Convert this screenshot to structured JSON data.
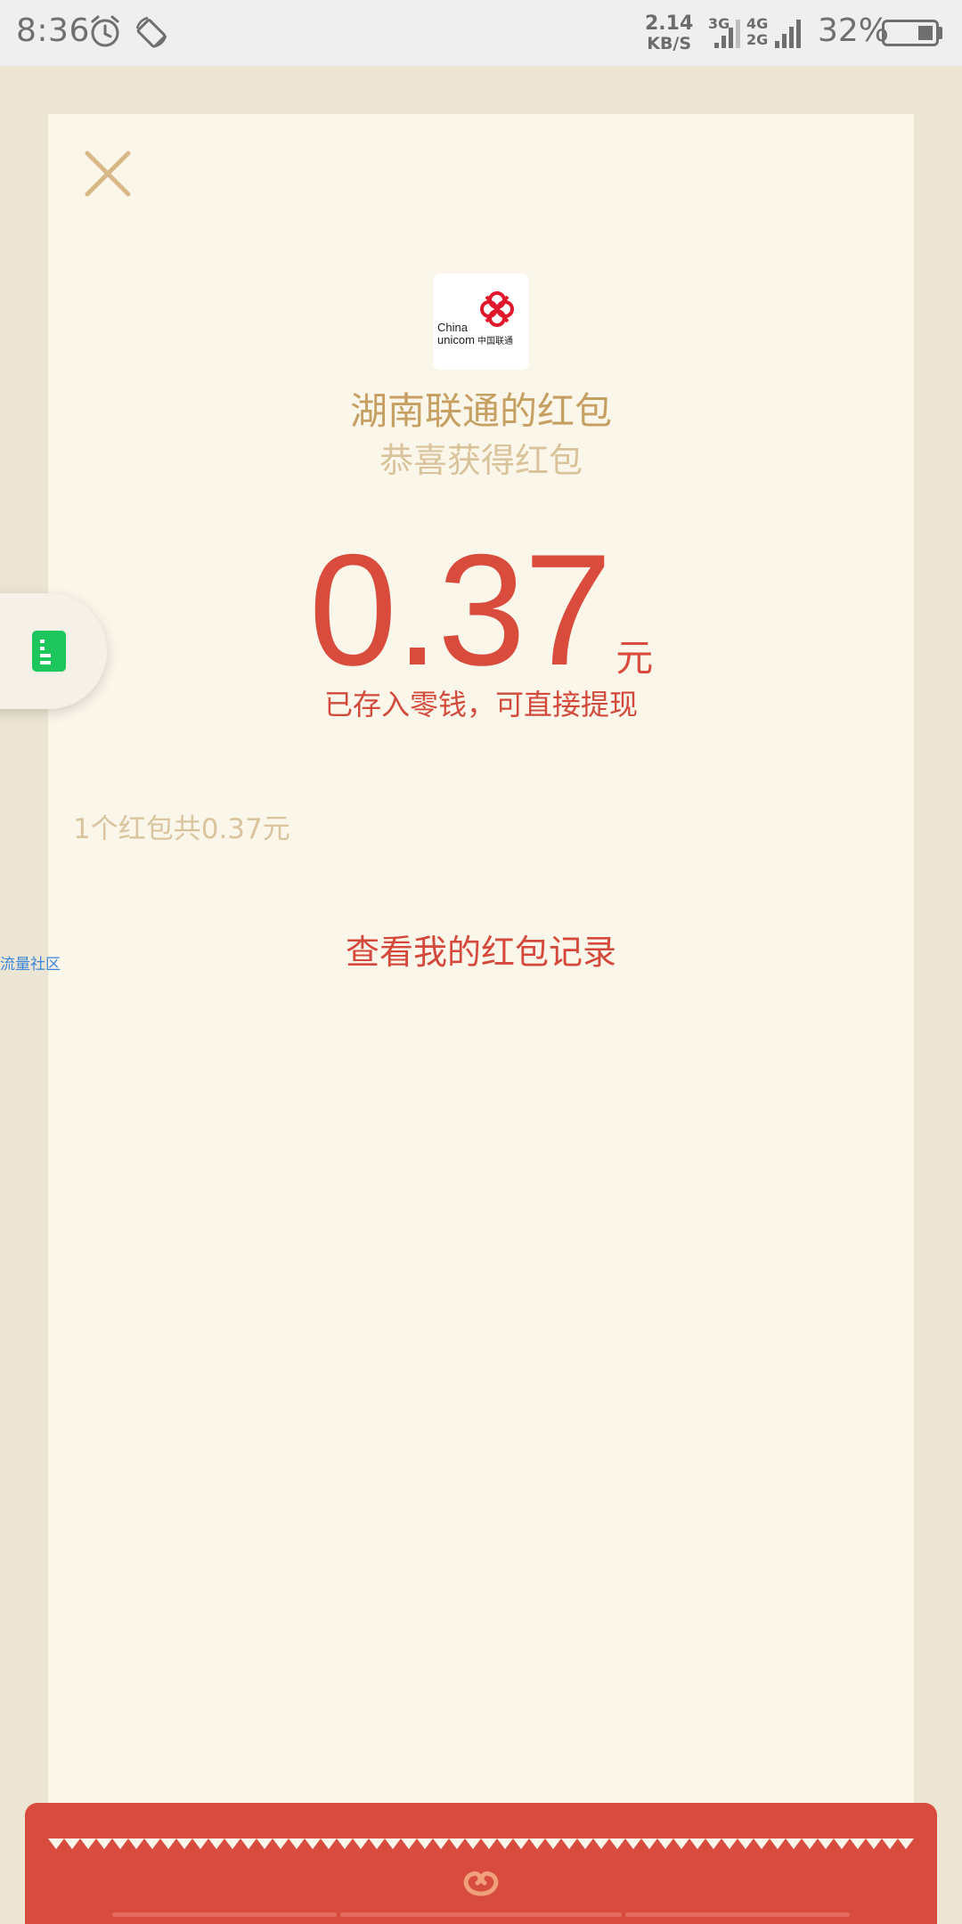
{
  "status_bar": {
    "time": "8:36",
    "net_speed_value": "2.14",
    "net_speed_unit": "KB/S",
    "sim1_label": "3G",
    "sim2_top": "4G",
    "sim2_bottom": "2G",
    "battery_text": "32%",
    "icons": [
      "alarm-icon",
      "rotate-icon",
      "signal-icon",
      "battery-icon"
    ]
  },
  "red_packet": {
    "logo_text_line1": "China",
    "logo_text_line2": "unicom",
    "logo_text_cn": "中国联通",
    "sender": "湖南联通的红包",
    "greeting": "恭喜获得红包",
    "amount": "0.37",
    "unit": "元",
    "stored_note": "已存入零钱，可直接提现",
    "summary": "1个红包共0.37元",
    "records_link": "查看我的红包记录"
  },
  "side_link": "流量社区",
  "colors": {
    "accent_red": "#d94b3c",
    "gold": "#c6a062",
    "card_bg": "#fbf6ea",
    "page_bg": "#ede5d3",
    "float_icon_green": "#1ec75d",
    "link_blue": "#3b86d8"
  }
}
